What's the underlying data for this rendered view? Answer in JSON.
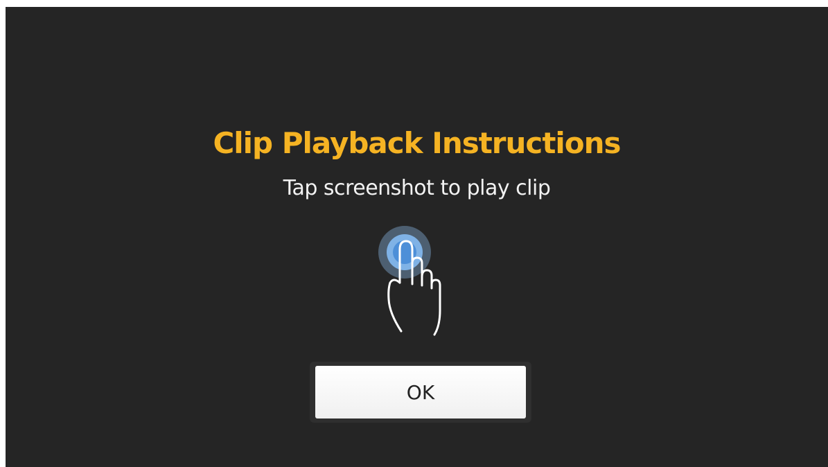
{
  "dialog": {
    "title": "Clip Playback Instructions",
    "message": "Tap screenshot to play clip",
    "icon": "tap-hand-icon",
    "ok_label": "OK"
  },
  "colors": {
    "background": "#252525",
    "title": "#f5b323",
    "message": "#f2f2f2",
    "tap_highlight": "#5b9bd5"
  }
}
